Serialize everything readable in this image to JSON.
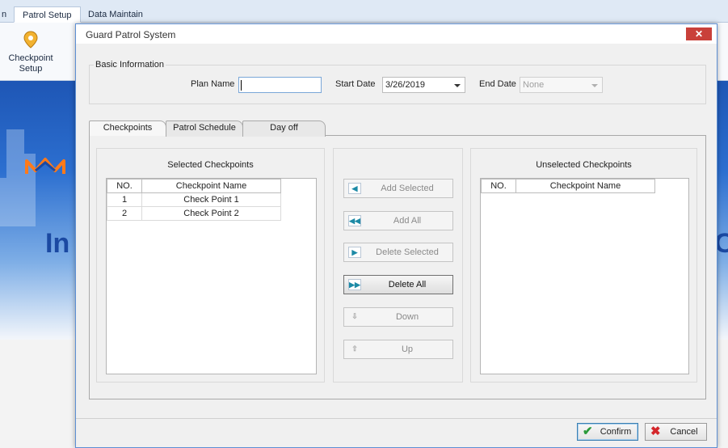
{
  "app": {
    "ribbon_tabs": [
      "n",
      "Patrol Setup",
      "Data Maintain"
    ],
    "ribbon_button": "Checkpoint Setup",
    "banner_fragment_left": "In",
    "banner_fragment_right": "O"
  },
  "dialog": {
    "title": "Guard Patrol System",
    "close_glyph": "✕",
    "basic_info": {
      "group_label": "Basic Information",
      "plan_name_label": "Plan Name",
      "plan_name_value": "",
      "start_date_label": "Start Date",
      "start_date_value": "3/26/2019",
      "end_date_label": "End Date",
      "end_date_value": "None"
    },
    "tabs": [
      "Checkpoints",
      "Patrol Schedule",
      "Day off"
    ],
    "selected": {
      "title": "Selected Checkpoints",
      "columns": [
        "NO.",
        "Checkpoint Name"
      ],
      "rows": [
        {
          "no": "1",
          "name": "Check Point 1"
        },
        {
          "no": "2",
          "name": "Check Point 2"
        }
      ]
    },
    "unselected": {
      "title": "Unselected Checkpoints",
      "columns": [
        "NO.",
        "Checkpoint Name"
      ],
      "rows": []
    },
    "actions": {
      "add_selected": "Add Selected",
      "add_all": "Add All",
      "delete_selected": "Delete Selected",
      "delete_all": "Delete All",
      "down": "Down",
      "up": "Up"
    },
    "footer": {
      "confirm": "Confirm",
      "cancel": "Cancel"
    }
  },
  "colors": {
    "accent_blue": "#5d8fd4",
    "close_red": "#c9403a",
    "confirm_green": "#2a9a3a",
    "cancel_red": "#d4262a",
    "banner_blue": "#1e56b5"
  }
}
